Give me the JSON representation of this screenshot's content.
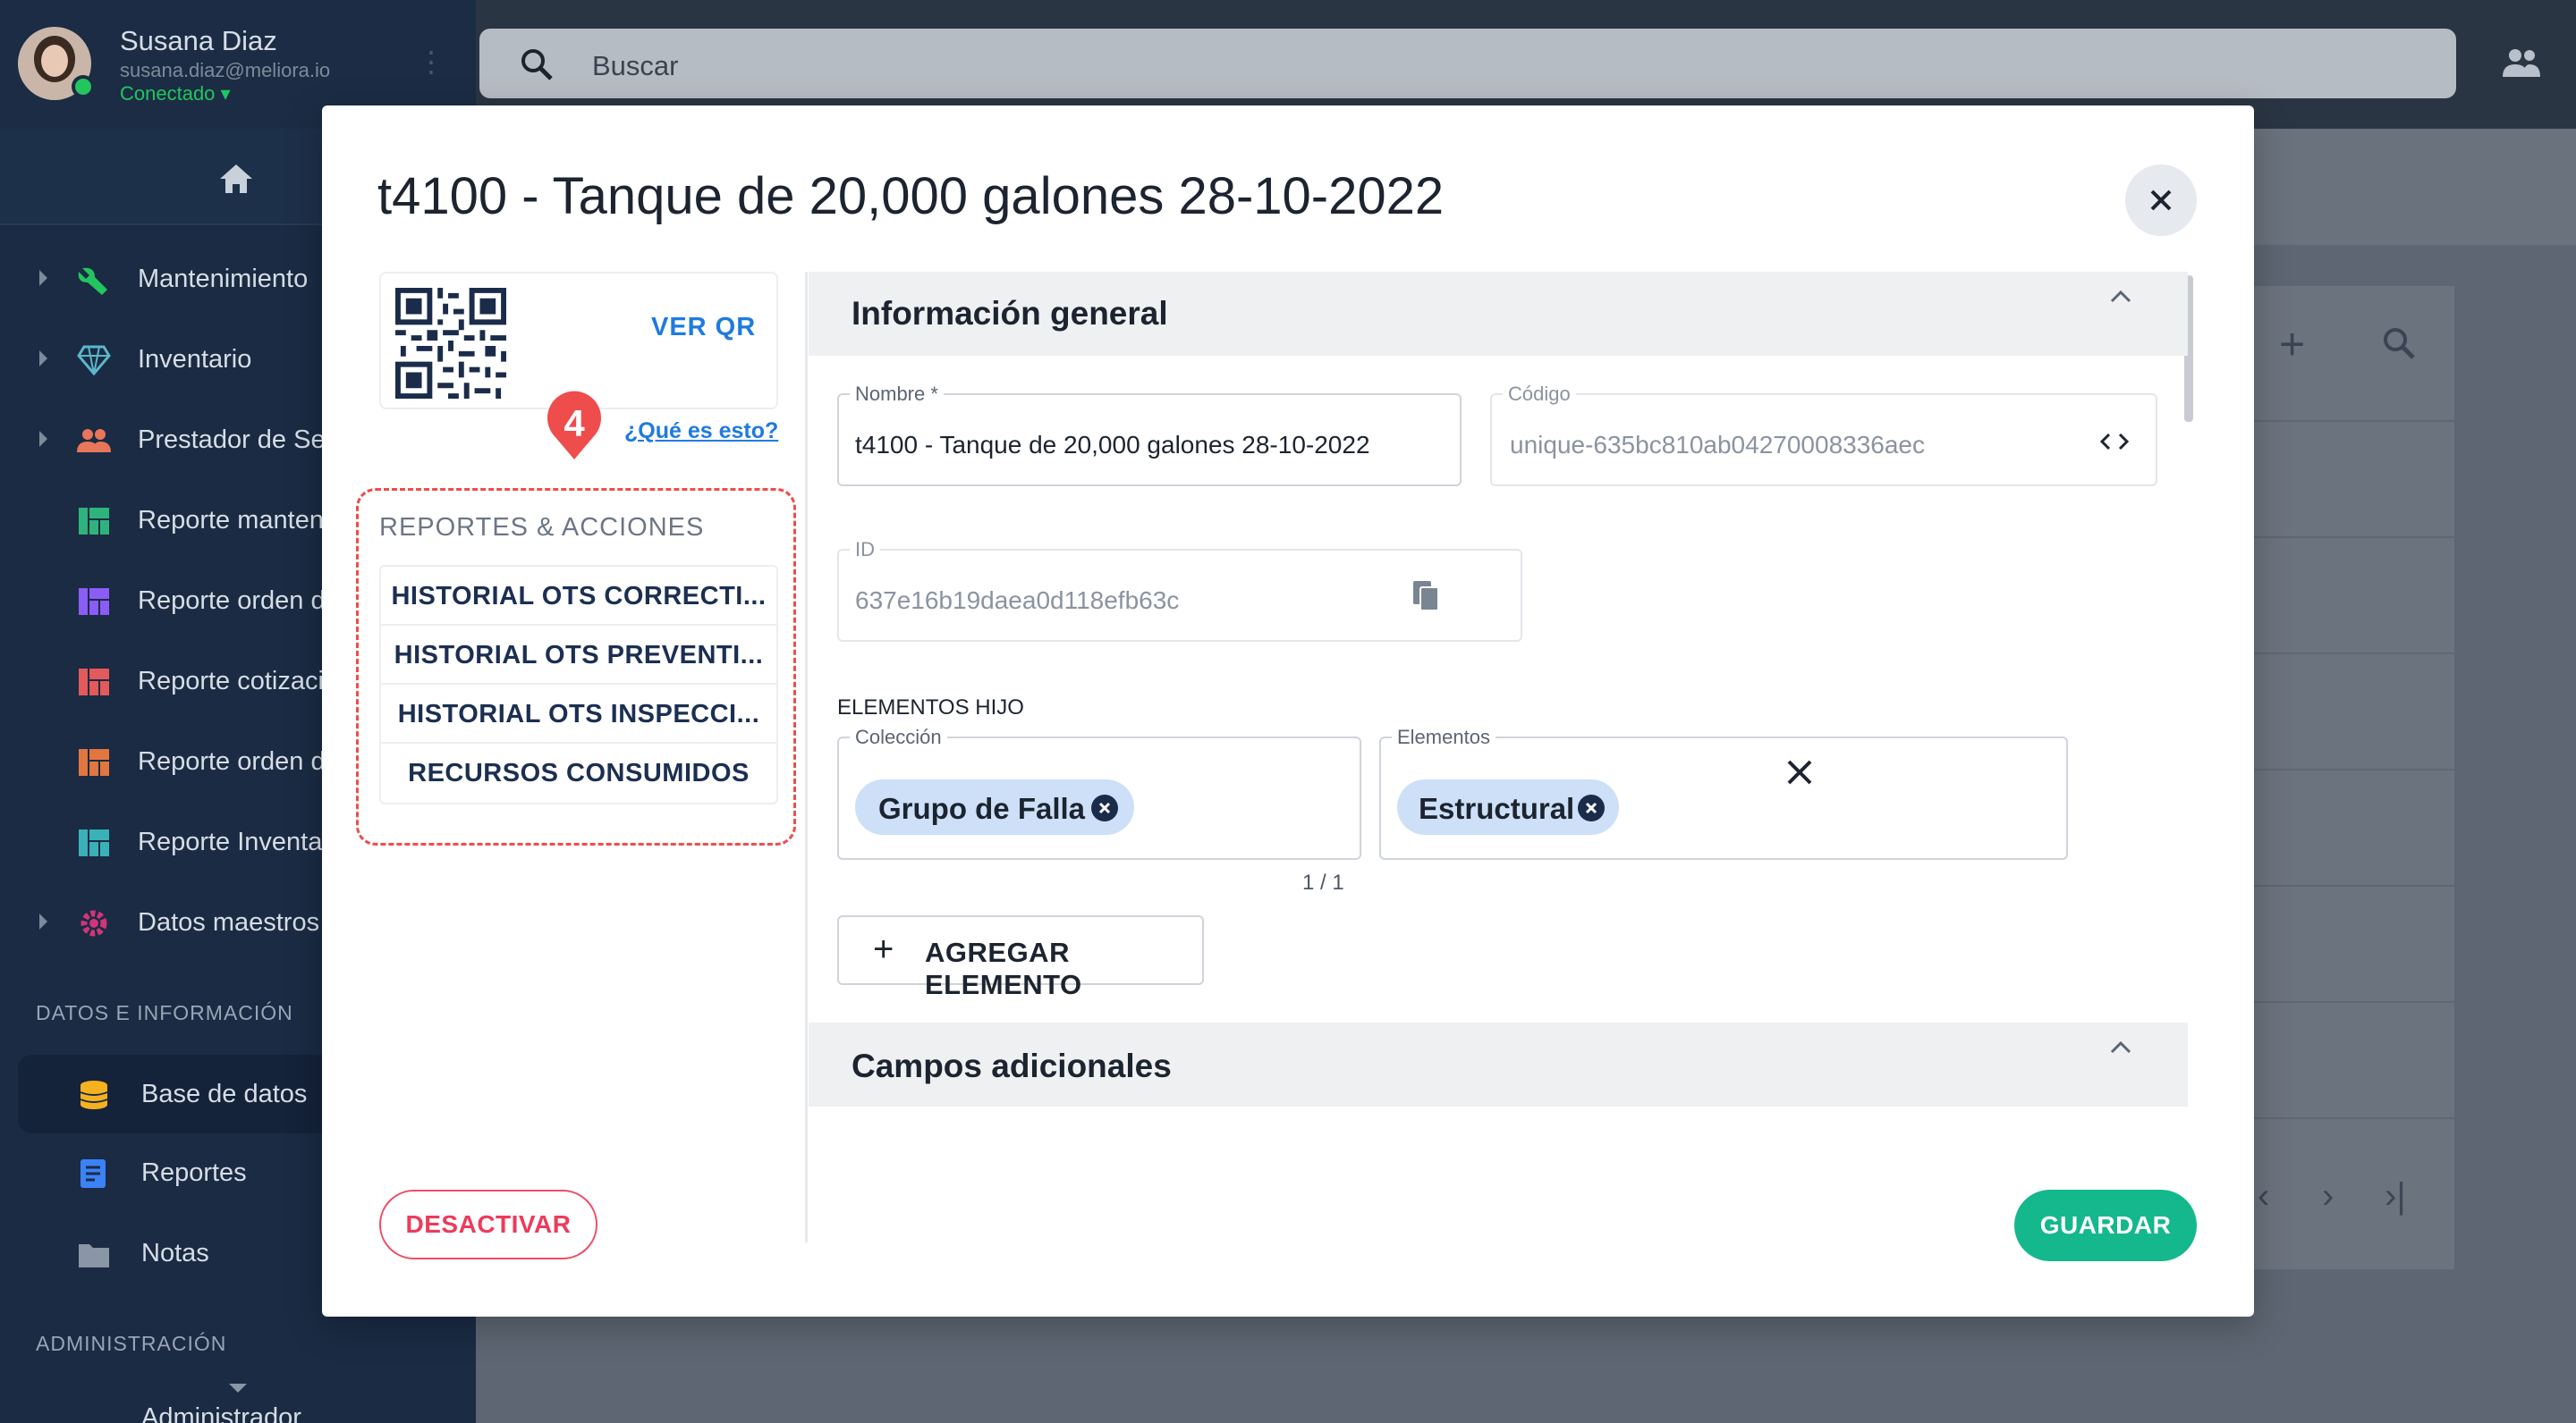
{
  "user": {
    "name": "Susana Diaz",
    "email": "susana.diaz@meliora.io",
    "status": "Conectado"
  },
  "search": {
    "placeholder": "Buscar"
  },
  "sidebar": {
    "items": [
      {
        "label": "Mantenimiento",
        "icon": "wrench-icon",
        "color": "#22c55e"
      },
      {
        "label": "Inventario",
        "icon": "gem-icon",
        "color": "#5bb7c9"
      },
      {
        "label": "Prestador de Servicios",
        "icon": "people-icon",
        "color": "#e8765a"
      },
      {
        "label": "Reporte mantenimiento",
        "icon": "dashboard-icon",
        "color": "#2fb37c"
      },
      {
        "label": "Reporte orden de",
        "icon": "dashboard-icon",
        "color": "#8b5cf6"
      },
      {
        "label": "Reporte cotización",
        "icon": "dashboard-icon",
        "color": "#e25a5a"
      },
      {
        "label": "Reporte orden de",
        "icon": "dashboard-icon",
        "color": "#e2763f"
      },
      {
        "label": "Reporte Inventario",
        "icon": "dashboard-icon",
        "color": "#3ab1b8"
      },
      {
        "label": "Datos maestros",
        "icon": "gear-icon",
        "color": "#d1357a"
      }
    ],
    "section_data": "DATOS E INFORMACIÓN",
    "data_items": [
      {
        "label": "Base de datos",
        "icon": "database-icon",
        "color": "#f5b21f"
      },
      {
        "label": "Reportes",
        "icon": "document-icon",
        "color": "#3b82f6"
      },
      {
        "label": "Notas",
        "icon": "folder-icon",
        "color": "#8a95a5"
      }
    ],
    "section_admin": "ADMINISTRACIÓN",
    "admin_partial": "Administrador"
  },
  "modal": {
    "title": "t4100 - Tanque de 20,000 galones 28-10-2022",
    "ver_qr": "VER QR",
    "que_es": "¿Qué es esto?",
    "reports_title": "REPORTES & ACCIONES",
    "reports": [
      "HISTORIAL OTS CORRECTI...",
      "HISTORIAL OTS PREVENTI...",
      "HISTORIAL OTS INSPECCI...",
      "RECURSOS CONSUMIDOS"
    ],
    "badge_number": "4",
    "general_section": "Información general",
    "nombre_label": "Nombre *",
    "nombre_value": "t4100 - Tanque de 20,000 galones 28-10-2022",
    "codigo_label": "Código",
    "codigo_value": "unique-635bc810ab04270008336aec",
    "id_label": "ID",
    "id_value": "637e16b19daea0d118efb63c",
    "elementos_hijo": "ELEMENTOS HIJO",
    "coleccion_label": "Colección",
    "coleccion_chip": "Grupo de Falla",
    "elementos_label": "Elementos",
    "elementos_chip": "Estructural",
    "pager": "1 / 1",
    "add_element": "AGREGAR ELEMENTO",
    "additional_section": "Campos adicionales",
    "desactivar": "DESACTIVAR",
    "guardar": "GUARDAR"
  }
}
